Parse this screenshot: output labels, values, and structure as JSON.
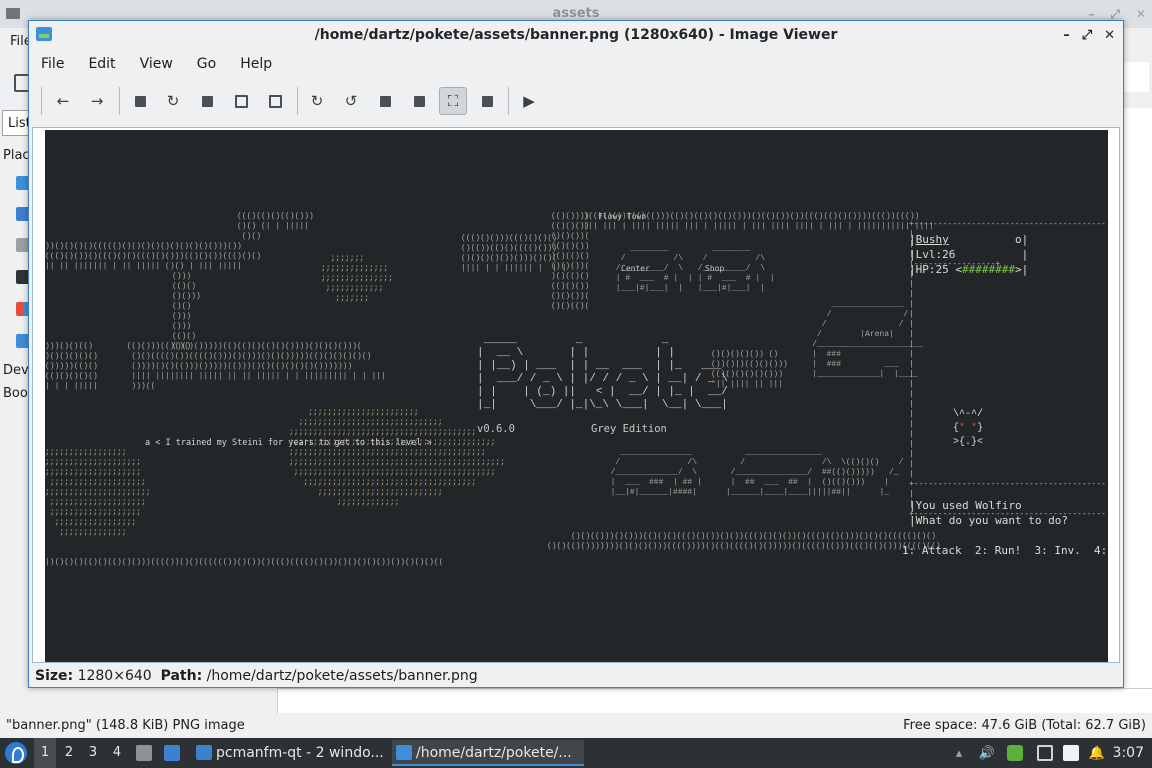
{
  "file_manager": {
    "title": "assets",
    "menu_file": "File",
    "list_tab": "List",
    "places_label": "Places",
    "devices_label": "Devices",
    "bookmarks_label": "Bookmarks",
    "status_left": "\"banner.png\" (148.8 KiB) PNG image",
    "status_right": "Free space: 47.6 GiB (Total: 62.7 GiB)"
  },
  "viewer": {
    "title": "/home/dartz/pokete/assets/banner.png (1280x640) - Image Viewer",
    "menu": [
      "File",
      "Edit",
      "View",
      "Go",
      "Help"
    ],
    "info": {
      "size_label": "Size:",
      "size_value": "1280×640",
      "path_label": "Path:",
      "path_value": "/home/dartz/pokete/assets/banner.png"
    },
    "banner": {
      "version": "v0.6.0",
      "edition": "Grey Edition",
      "town_label": "Flowy Town",
      "center_label": "Center",
      "shop_label": "Shop",
      "arena_label": "Arena",
      "quote": "a < I trained my Steini for years to get to this level >",
      "hud": {
        "name": "Bushy",
        "level": "Lvl:26",
        "hp": "HP:25",
        "hp_bar": "########",
        "message_1": "You used Wolfiro",
        "message_2": "What do you want to do?",
        "actions": "1: Attack  2: Run!  3: Inv.  4:"
      }
    }
  },
  "taskbar": {
    "workspaces": [
      "1",
      "2",
      "3",
      "4"
    ],
    "tasks": [
      {
        "label": "pcmanfm-qt - 2 windo..."
      },
      {
        "label": "/home/dartz/pokete/..."
      }
    ],
    "clock": "3:07"
  },
  "colors": {
    "accent": "#3d8fd9",
    "image_background": "#232629",
    "taskbar": "#2c3134"
  }
}
